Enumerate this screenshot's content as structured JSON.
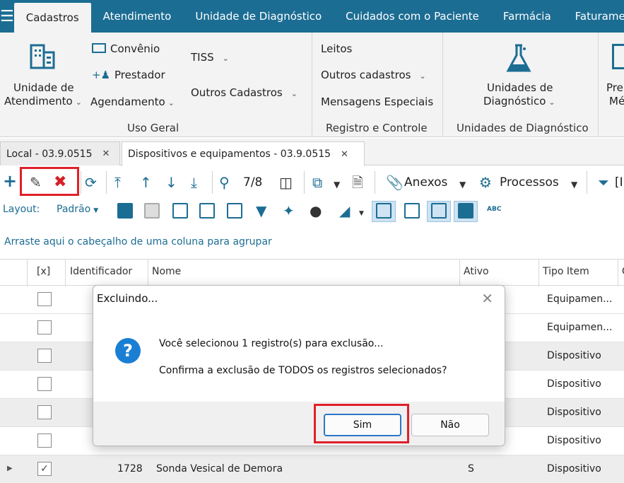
{
  "menubar": {
    "tabs": [
      "Cadastros",
      "Atendimento",
      "Unidade de Diagnóstico",
      "Cuidados com o Paciente",
      "Farmácia",
      "Faturame"
    ],
    "active": "Cadastros"
  },
  "ribbon": {
    "unidade_atendimento_l1": "Unidade de",
    "unidade_atendimento_l2": "Atendimento",
    "convenio": "Convênio",
    "prestador": "Prestador",
    "agendamento": "Agendamento",
    "tiss": "TISS",
    "outros_cadastros": "Outros Cadastros",
    "uso_geral": "Uso Geral",
    "leitos": "Leitos",
    "outros_cadastros2": "Outros cadastros",
    "mensagens_especiais": "Mensagens  Especiais",
    "registro_controle": "Registro e Controle",
    "unidades_diag_l1": "Unidades de",
    "unidades_diag_l2": "Diagnóstico",
    "unidades_diag_group": "Unidades de Diagnóstico",
    "cut_l1": "Pre",
    "cut_l2": "Mé"
  },
  "doctabs": [
    {
      "label": "Local - 03.9.0515"
    },
    {
      "label": "Dispositivos e equipamentos - 03.9.0515"
    }
  ],
  "toolbar": {
    "record_count": "7/8",
    "anexos": "Anexos",
    "processos": "Processos",
    "filter_cut": "[I"
  },
  "toolbar2": {
    "layout_label": "Layout:",
    "layout_value": "Padrão",
    "abc": "ABC"
  },
  "group_hint": "Arraste aqui o cabeçalho de uma coluna para agrupar",
  "grid": {
    "headers": [
      "[x]",
      "Identificador",
      "Nome",
      "Ativo",
      "Tipo Item",
      "C"
    ],
    "rows": [
      {
        "id": "",
        "nome": "",
        "ativo": "",
        "tipo": "Equipamen...",
        "checked": false
      },
      {
        "id": "",
        "nome": "",
        "ativo": "",
        "tipo": "Equipamen...",
        "checked": false
      },
      {
        "id": "",
        "nome": "",
        "ativo": "",
        "tipo": "Dispositivo",
        "checked": false
      },
      {
        "id": "",
        "nome": "",
        "ativo": "",
        "tipo": "Dispositivo",
        "checked": false
      },
      {
        "id": "",
        "nome": "",
        "ativo": "",
        "tipo": "Dispositivo",
        "checked": false
      },
      {
        "id": "",
        "nome": "",
        "ativo": "",
        "tipo": "Dispositivo",
        "checked": false
      },
      {
        "id": "1728",
        "nome": "Sonda Vesical de Demora",
        "ativo": "S",
        "tipo": "Dispositivo",
        "checked": true
      }
    ]
  },
  "dialog": {
    "title": "Excluindo...",
    "line1": "Você selecionou 1 registro(s) para exclusão...",
    "line2": "Confirma a exclusão de TODOS os registros selecionados?",
    "yes": "Sim",
    "no": "Não"
  },
  "colors": {
    "brand": "#1c6d93",
    "highlight_red": "#e0202a",
    "info_blue": "#1a7fd4"
  }
}
